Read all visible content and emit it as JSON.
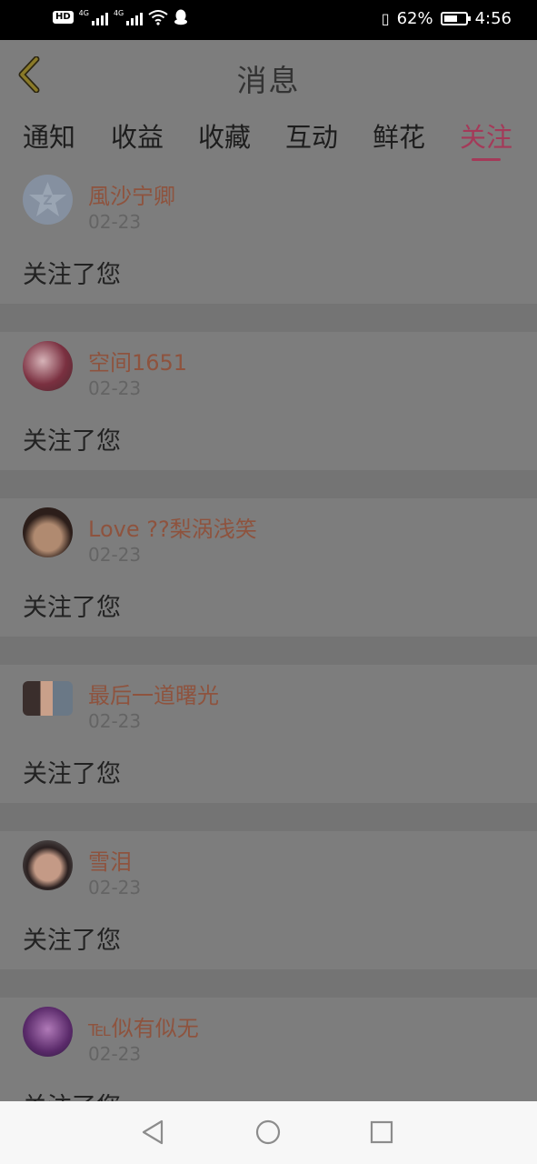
{
  "status_bar": {
    "hd": "HD",
    "sim1": "4G",
    "sim2": "4G",
    "battery_pct": "62%",
    "battery_level": 0.62,
    "time": "4:56",
    "icons": [
      "hd-icon",
      "signal-icon",
      "wifi-icon",
      "qq-icon",
      "vibrate-icon",
      "battery-icon"
    ]
  },
  "header": {
    "title": "消息",
    "back_icon": "chevron-left-icon"
  },
  "tabs": [
    {
      "label": "通知",
      "active": false
    },
    {
      "label": "收益",
      "active": false
    },
    {
      "label": "收藏",
      "active": false
    },
    {
      "label": "互动",
      "active": false
    },
    {
      "label": "鲜花",
      "active": false
    },
    {
      "label": "关注",
      "active": true
    }
  ],
  "notifications": [
    {
      "username": "風沙宁卿",
      "date": "02-23",
      "action": "关注了您"
    },
    {
      "username": "空间1651",
      "date": "02-23",
      "action": "关注了您"
    },
    {
      "username": "Love ??梨涡浅笑",
      "date": "02-23",
      "action": "关注了您"
    },
    {
      "username": "最后一道曙光",
      "date": "02-23",
      "action": "关注了您"
    },
    {
      "username": "雪泪",
      "date": "02-23",
      "action": "关注了您"
    },
    {
      "username": "℡似有似无",
      "date": "02-23",
      "action": "关注了您"
    }
  ],
  "colors": {
    "overlay_bg": "#7d7d7d",
    "accent": "#a43a59",
    "username": "#8e533e",
    "nav_bg": "#f7f7f7"
  },
  "navbar": {
    "icons": [
      "back-triangle-icon",
      "home-circle-icon",
      "recents-square-icon"
    ]
  }
}
